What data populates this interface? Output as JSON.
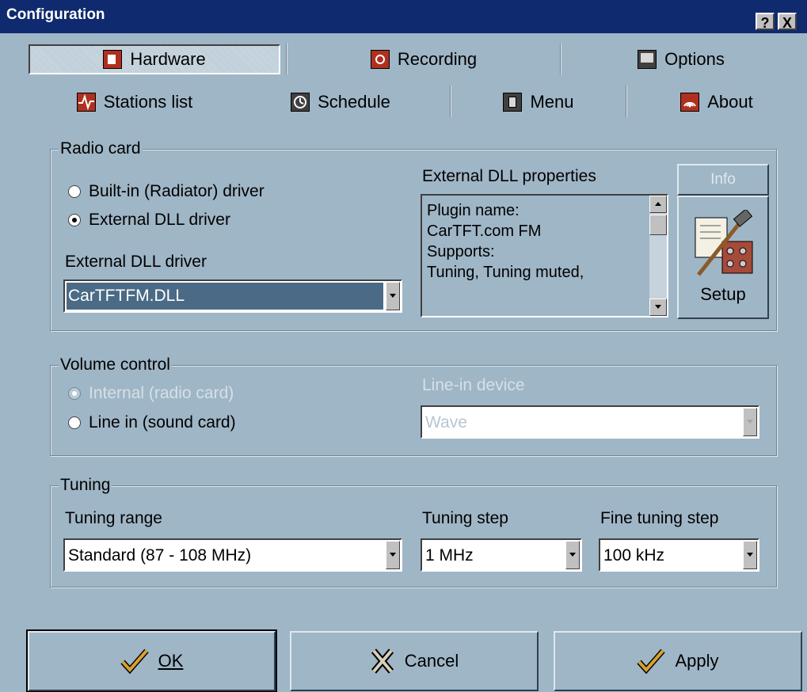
{
  "window": {
    "title": "Configuration",
    "help_button": "?",
    "close_button": "X"
  },
  "tabs_row1": [
    {
      "label": "Hardware",
      "icon": "hardware-icon",
      "selected": true
    },
    {
      "label": "Recording",
      "icon": "recording-icon",
      "selected": false
    },
    {
      "label": "Options",
      "icon": "options-icon",
      "selected": false
    }
  ],
  "tabs_row2": [
    {
      "label": "Stations list",
      "icon": "stations-list-icon"
    },
    {
      "label": "Schedule",
      "icon": "schedule-icon"
    },
    {
      "label": "Menu",
      "icon": "menu-icon"
    },
    {
      "label": "About",
      "icon": "about-icon"
    }
  ],
  "radio_card": {
    "legend": "Radio card",
    "builtin_label": "Built-in (Radiator) driver",
    "external_label": "External DLL driver",
    "selected": "external",
    "dll_driver_label": "External DLL driver",
    "dll_driver_value": "CarTFTFM.DLL",
    "properties_label": "External DLL properties",
    "properties_lines": [
      "Plugin name:",
      "CarTFT.com FM",
      "Supports:",
      "Tuning, Tuning muted,"
    ],
    "info_button": "Info",
    "setup_button": "Setup"
  },
  "volume_control": {
    "legend": "Volume control",
    "internal_label": "Internal (radio card)",
    "line_in_label": "Line in (sound card)",
    "device_label": "Line-in device",
    "device_value": "Wave"
  },
  "tuning": {
    "legend": "Tuning",
    "range_label": "Tuning range",
    "range_value": "Standard (87 - 108 MHz)",
    "step_label": "Tuning step",
    "step_value": "1 MHz",
    "fine_label": "Fine tuning step",
    "fine_value": "100 kHz"
  },
  "buttons": {
    "ok": "OK",
    "cancel": "Cancel",
    "apply": "Apply"
  },
  "colors": {
    "background": "#9fb6c6",
    "titlebar": "#0f2a6e",
    "selection": "#4a6a86"
  }
}
